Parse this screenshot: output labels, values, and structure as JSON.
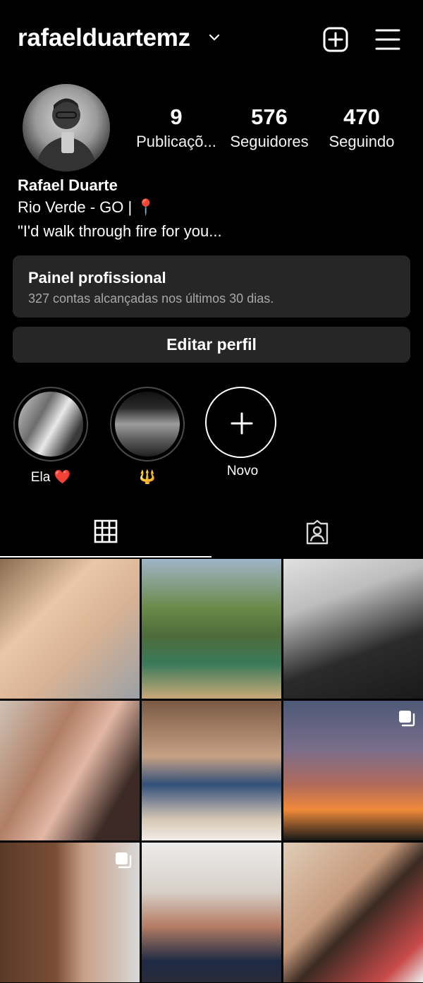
{
  "header": {
    "username": "rafaelduartemz"
  },
  "stats": [
    {
      "count": "9",
      "label": "Publicaçõ..."
    },
    {
      "count": "576",
      "label": "Seguidores"
    },
    {
      "count": "470",
      "label": "Seguindo"
    }
  ],
  "profile": {
    "name": "Rafael Duarte",
    "bio_line1": "Rio Verde - GO | 📍",
    "bio_line2": "\"I'd walk through fire for you..."
  },
  "pro_panel": {
    "title": "Painel profissional",
    "subtitle": "327 contas alcançadas nos últimos 30 dias."
  },
  "edit_button": "Editar perfil",
  "highlights": [
    {
      "label": "Ela ❤️"
    },
    {
      "label": "🔱"
    },
    {
      "label": "Novo"
    }
  ],
  "icons": {
    "dropdown": "chevron-down-icon",
    "new_post": "plus-square-icon",
    "menu": "hamburger-menu-icon",
    "grid_tab": "grid-icon",
    "tagged_tab": "tagged-person-icon",
    "multi_post": "carousel-icon"
  },
  "colors": {
    "background": "#000000",
    "panel": "#262626",
    "secondary_text": "#a8a8a8"
  }
}
